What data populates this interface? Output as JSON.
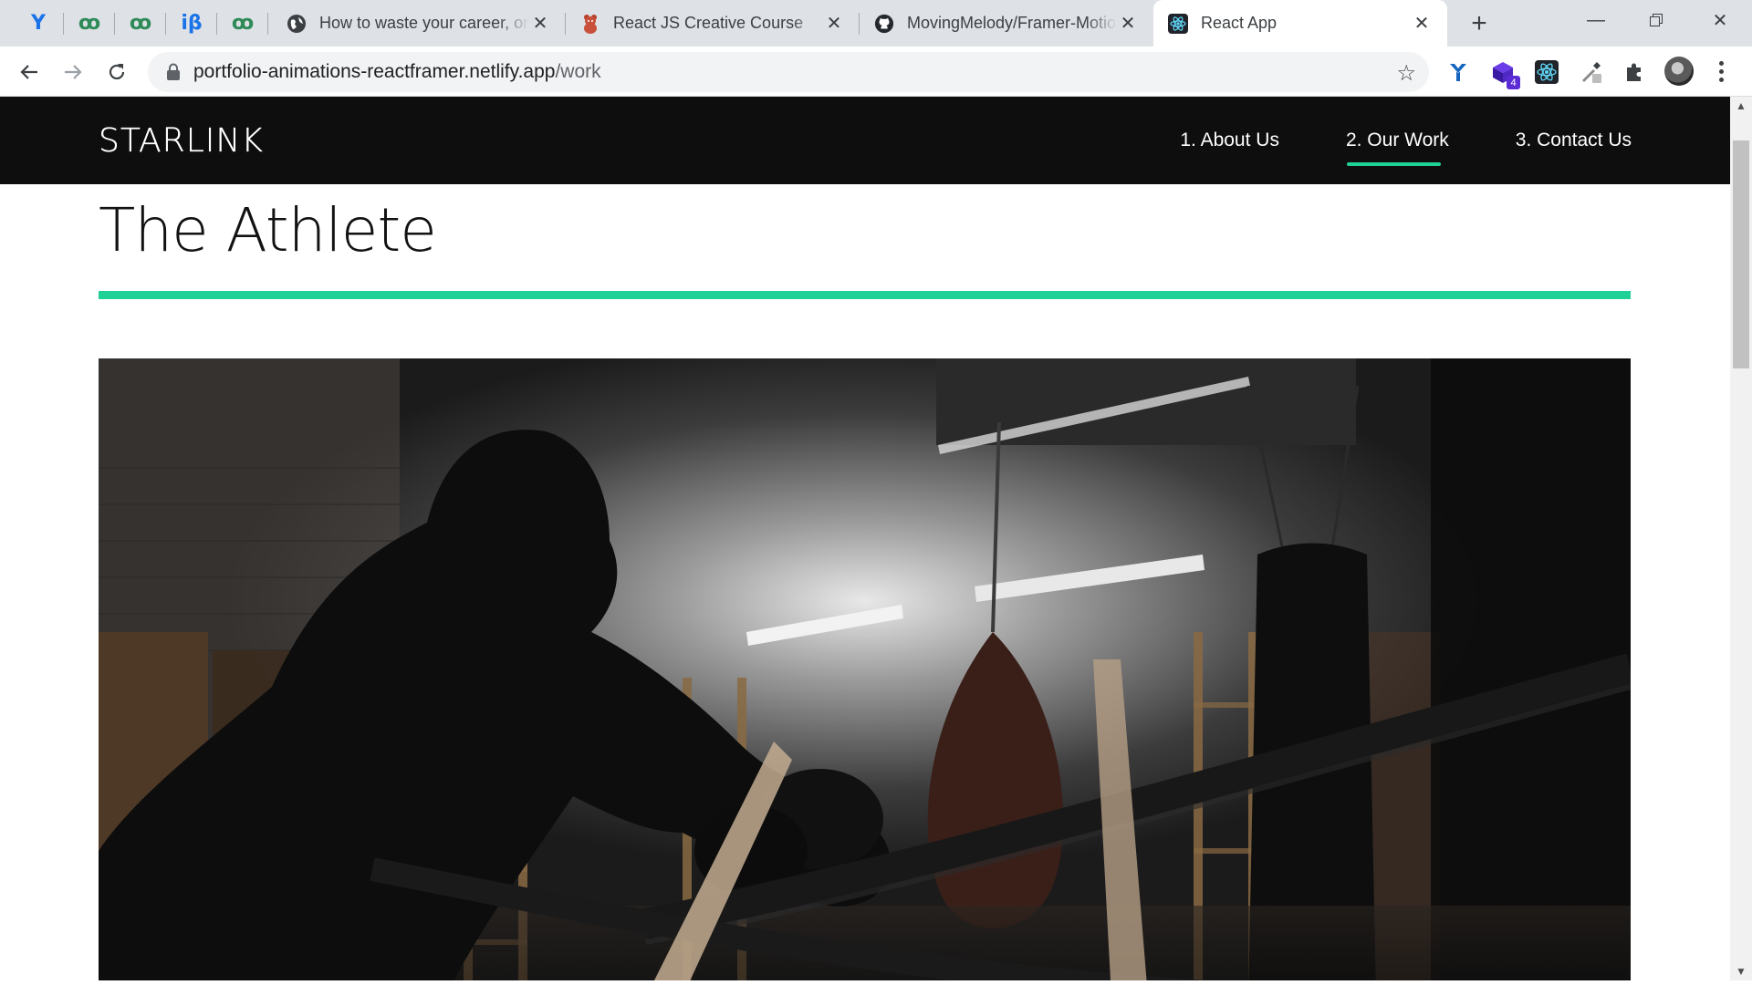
{
  "browser": {
    "tabs": [
      {
        "kind": "pinned",
        "icon": "y-brand-icon"
      },
      {
        "kind": "pinned",
        "icon": "geeksforgeeks-icon"
      },
      {
        "kind": "pinned",
        "icon": "geeksforgeeks-icon"
      },
      {
        "kind": "pinned",
        "icon": "interviewbit-icon"
      },
      {
        "kind": "pinned",
        "icon": "geeksforgeeks-icon"
      },
      {
        "kind": "normal",
        "icon": "globe-icon",
        "title": "How to waste your career, one",
        "active": false
      },
      {
        "kind": "normal",
        "icon": "gummy-bear-icon",
        "title": "React JS Creative Course",
        "active": false
      },
      {
        "kind": "normal",
        "icon": "github-icon",
        "title": "MovingMelody/Framer-Motion",
        "active": false
      },
      {
        "kind": "normal",
        "icon": "react-icon",
        "title": "React App",
        "active": true
      }
    ],
    "pinned_glyphs": {
      "y": "Y",
      "gfg": "ꝏ",
      "ib": "iβ"
    },
    "url_host": "portfolio-animations-reactframer.netlify.app",
    "url_path": "/work",
    "extensions": [
      "y-brand-icon",
      "cube-extension-icon",
      "react-devtools-icon",
      "eyedropper-icon",
      "puzzle-icon"
    ],
    "extension_badge": "4",
    "colors": {
      "tabstrip": "#dee1e6",
      "omnibox": "#f1f3f4"
    }
  },
  "site": {
    "logo": "STARLINK",
    "nav": [
      {
        "label": "1. About Us",
        "active": false
      },
      {
        "label": "2. Our Work",
        "active": true
      },
      {
        "label": "3. Contact Us",
        "active": false
      }
    ],
    "page_title": "The Athlete",
    "colors": {
      "header_bg": "#0e0e0e",
      "accent": "#1fd196",
      "title": "#121212"
    }
  }
}
